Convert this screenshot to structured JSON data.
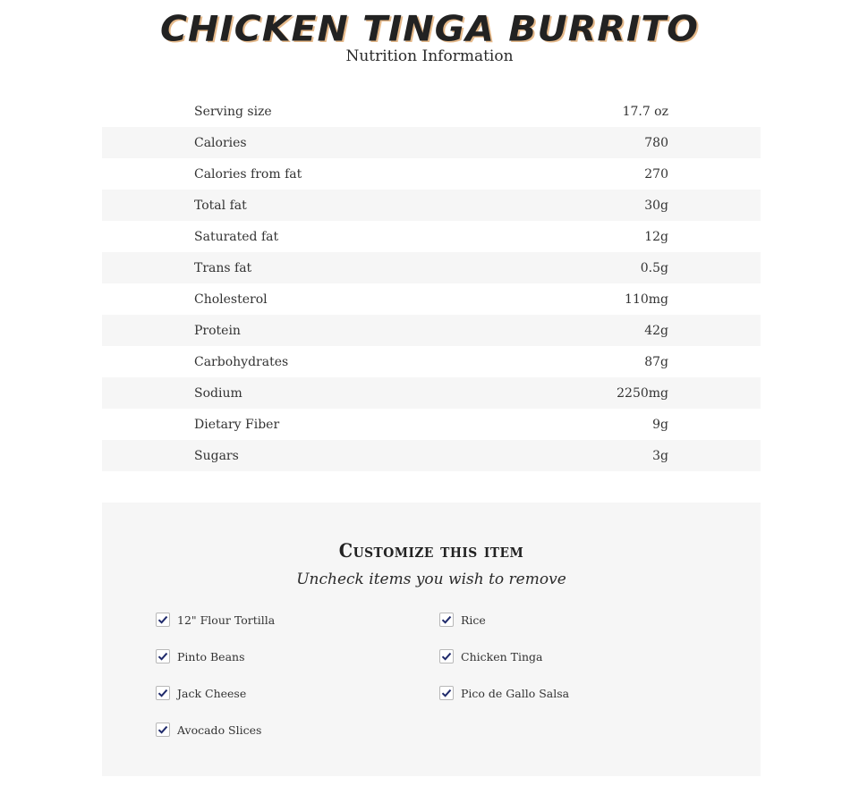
{
  "header": {
    "title": "CHICKEN TINGA BURRITO",
    "subtitle": "Nutrition Information"
  },
  "nutrition": [
    {
      "label": "Serving size",
      "value": "17.7 oz"
    },
    {
      "label": "Calories",
      "value": "780"
    },
    {
      "label": "Calories from fat",
      "value": "270"
    },
    {
      "label": "Total fat",
      "value": "30g"
    },
    {
      "label": "Saturated fat",
      "value": "12g"
    },
    {
      "label": "Trans fat",
      "value": "0.5g"
    },
    {
      "label": "Cholesterol",
      "value": "110mg"
    },
    {
      "label": "Protein",
      "value": "42g"
    },
    {
      "label": "Carbohydrates",
      "value": "87g"
    },
    {
      "label": "Sodium",
      "value": "2250mg"
    },
    {
      "label": "Dietary Fiber",
      "value": "9g"
    },
    {
      "label": "Sugars",
      "value": "3g"
    }
  ],
  "customize": {
    "title": "Customize this item",
    "subtitle": "Uncheck items you wish to remove",
    "options": [
      {
        "label": "12\" Flour Tortilla",
        "checked": true
      },
      {
        "label": "Rice",
        "checked": true
      },
      {
        "label": "Pinto Beans",
        "checked": true
      },
      {
        "label": "Chicken Tinga",
        "checked": true
      },
      {
        "label": "Jack Cheese",
        "checked": true
      },
      {
        "label": "Pico de Gallo Salsa",
        "checked": true
      },
      {
        "label": "Avocado Slices",
        "checked": true
      }
    ]
  },
  "colors": {
    "checkmark": "#1f2a6b",
    "row_stripe": "#f6f6f6",
    "title_shadow": "#e5b98a"
  }
}
